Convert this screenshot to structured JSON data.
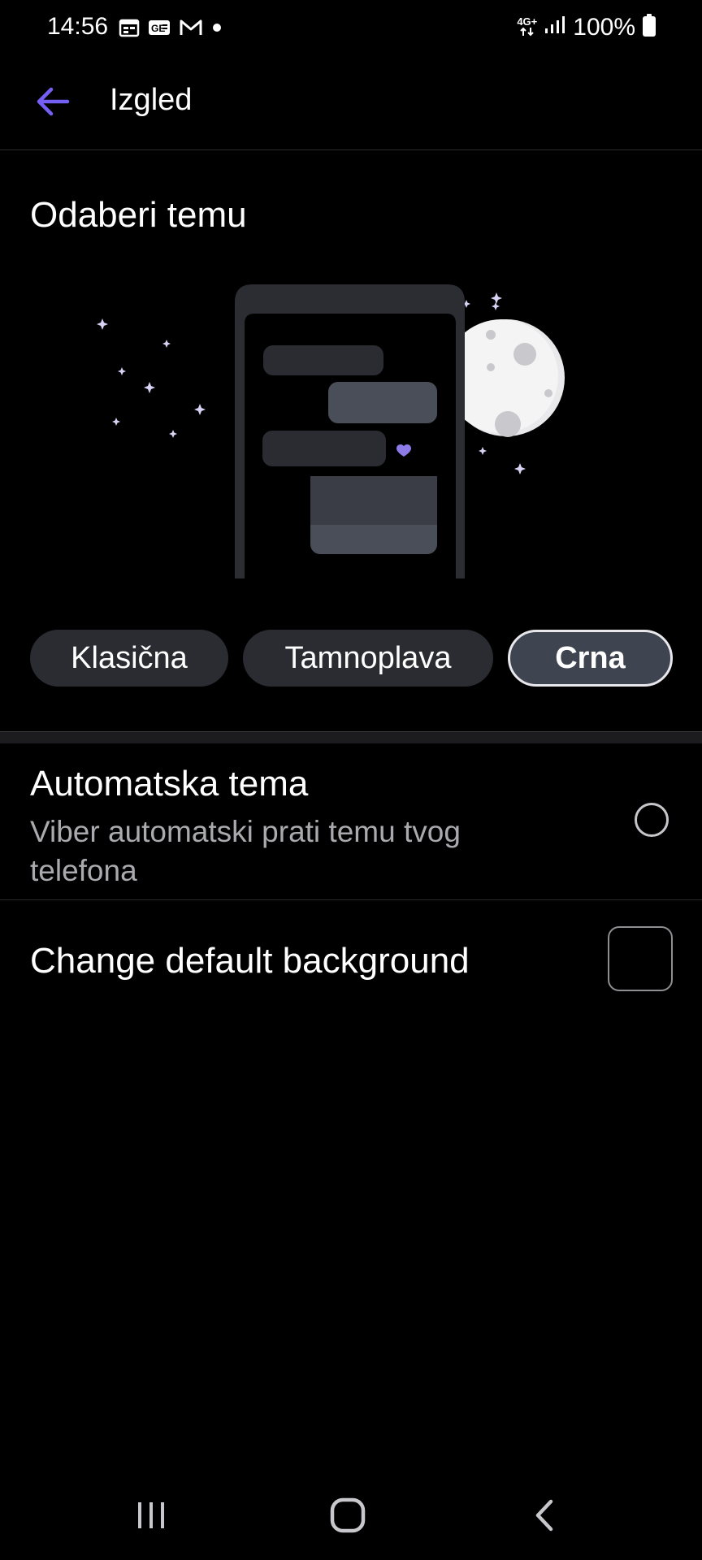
{
  "status_bar": {
    "time": "14:56",
    "notification_icons": [
      "calendar-icon",
      "news-icon",
      "gmail-icon",
      "dot-icon"
    ],
    "network_type": "4G+",
    "battery": "100%"
  },
  "toolbar": {
    "back_icon": "arrow-left-icon",
    "title": "Izgled"
  },
  "theme_section": {
    "title": "Odaberi temu",
    "options": [
      {
        "label": "Klasična",
        "selected": false
      },
      {
        "label": "Tamnoplava",
        "selected": false
      },
      {
        "label": "Crna",
        "selected": true
      }
    ]
  },
  "auto_theme": {
    "title": "Automatska tema",
    "description": "Viber automatski prati temu tvog telefona",
    "checked": false
  },
  "default_background": {
    "title": "Change default background"
  },
  "nav_bar": {
    "buttons": [
      "recent-apps-icon",
      "home-icon",
      "back-icon"
    ]
  },
  "colors": {
    "accent": "#7360f2",
    "background": "#000000",
    "chip": "#2a2c32",
    "chip_selected": "#3f4451"
  }
}
